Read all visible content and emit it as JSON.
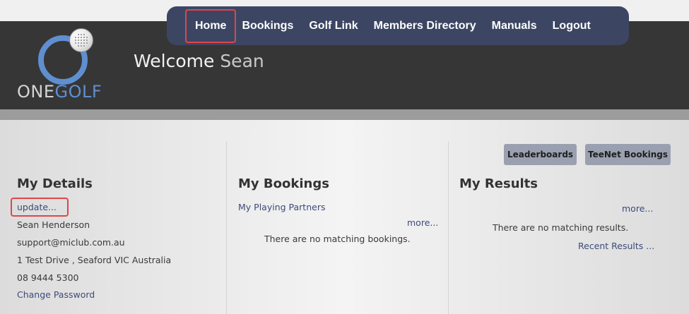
{
  "logo": {
    "part1": "ONE",
    "part2": "GOLF"
  },
  "welcome": {
    "greeting": "Welcome",
    "name": "Sean"
  },
  "nav": {
    "items": [
      "Home",
      "Bookings",
      "Golf Link",
      "Members Directory",
      "Manuals",
      "Logout"
    ]
  },
  "buttons": {
    "leaderboards": "Leaderboards",
    "teenet": "TeeNet Bookings"
  },
  "my_details": {
    "heading": "My Details",
    "update": "update...",
    "name": "Sean Henderson",
    "email": "support@miclub.com.au",
    "address": "1 Test Drive , Seaford VIC Australia",
    "phone": "08 9444 5300",
    "change_password": "Change Password"
  },
  "my_bookings": {
    "heading": "My Bookings",
    "partners": "My Playing Partners",
    "more": "more...",
    "empty": "There are no matching bookings."
  },
  "my_results": {
    "heading": "My Results",
    "more": "more...",
    "empty": "There are no matching results.",
    "recent": "Recent Results ..."
  },
  "colors": {
    "header_bg": "#363636",
    "nav_bg": "#3c4663",
    "accent_blue": "#5f8fd0",
    "highlight_red": "#e0454a",
    "button_bg": "#9aa0b0"
  }
}
